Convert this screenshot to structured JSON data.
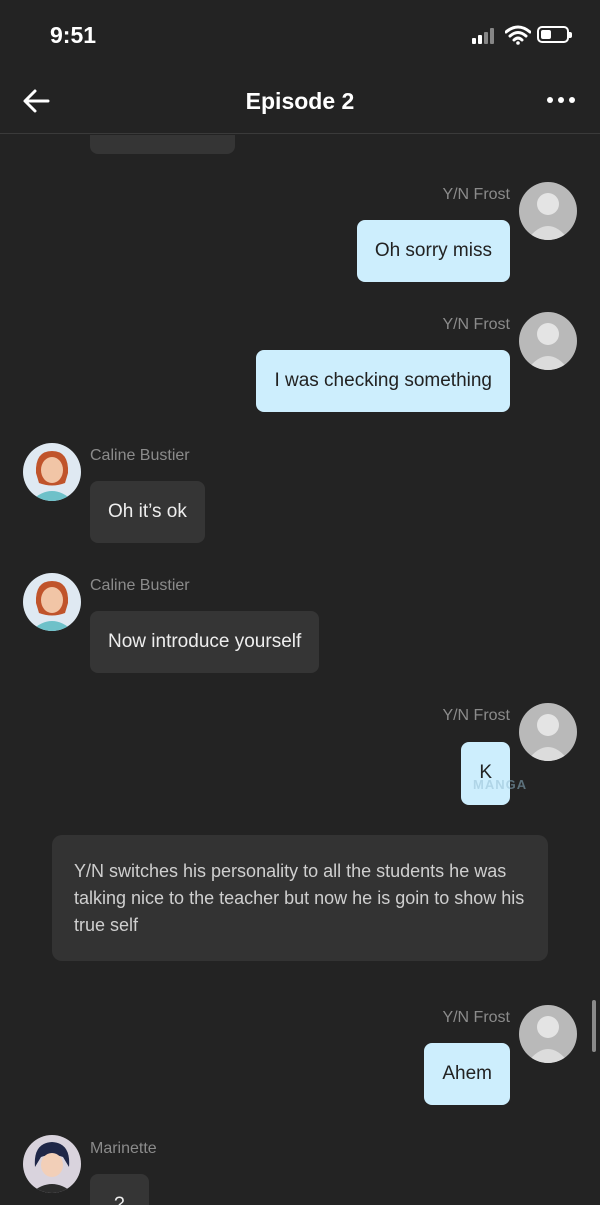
{
  "status": {
    "time": "9:51"
  },
  "header": {
    "title": "Episode 2",
    "back_icon": "arrow-left-icon",
    "more_icon": "ellipsis-icon"
  },
  "messages": [
    {
      "sender": "Y/N Frost",
      "text": "Oh sorry miss",
      "side": "right"
    },
    {
      "sender": "Y/N Frost",
      "text": "I was checking something",
      "side": "right"
    },
    {
      "sender": "Caline Bustier",
      "text": "Oh it’s ok",
      "side": "left"
    },
    {
      "sender": "Caline Bustier",
      "text": "Now introduce yourself",
      "side": "left"
    },
    {
      "sender": "Y/N Frost",
      "text": "K",
      "side": "right"
    },
    {
      "sender": "Y/N Frost",
      "text": "Ahem",
      "side": "right"
    },
    {
      "sender": "Marinette",
      "text": "?",
      "side": "left"
    }
  ],
  "narration": "Y/N switches his personality to all the students he was talking nice to the teacher but now he is goin to show his true self",
  "watermark": "MANGA",
  "colors": {
    "background": "#232323",
    "my_bubble": "#cdeefd",
    "their_bubble": "#353535"
  }
}
